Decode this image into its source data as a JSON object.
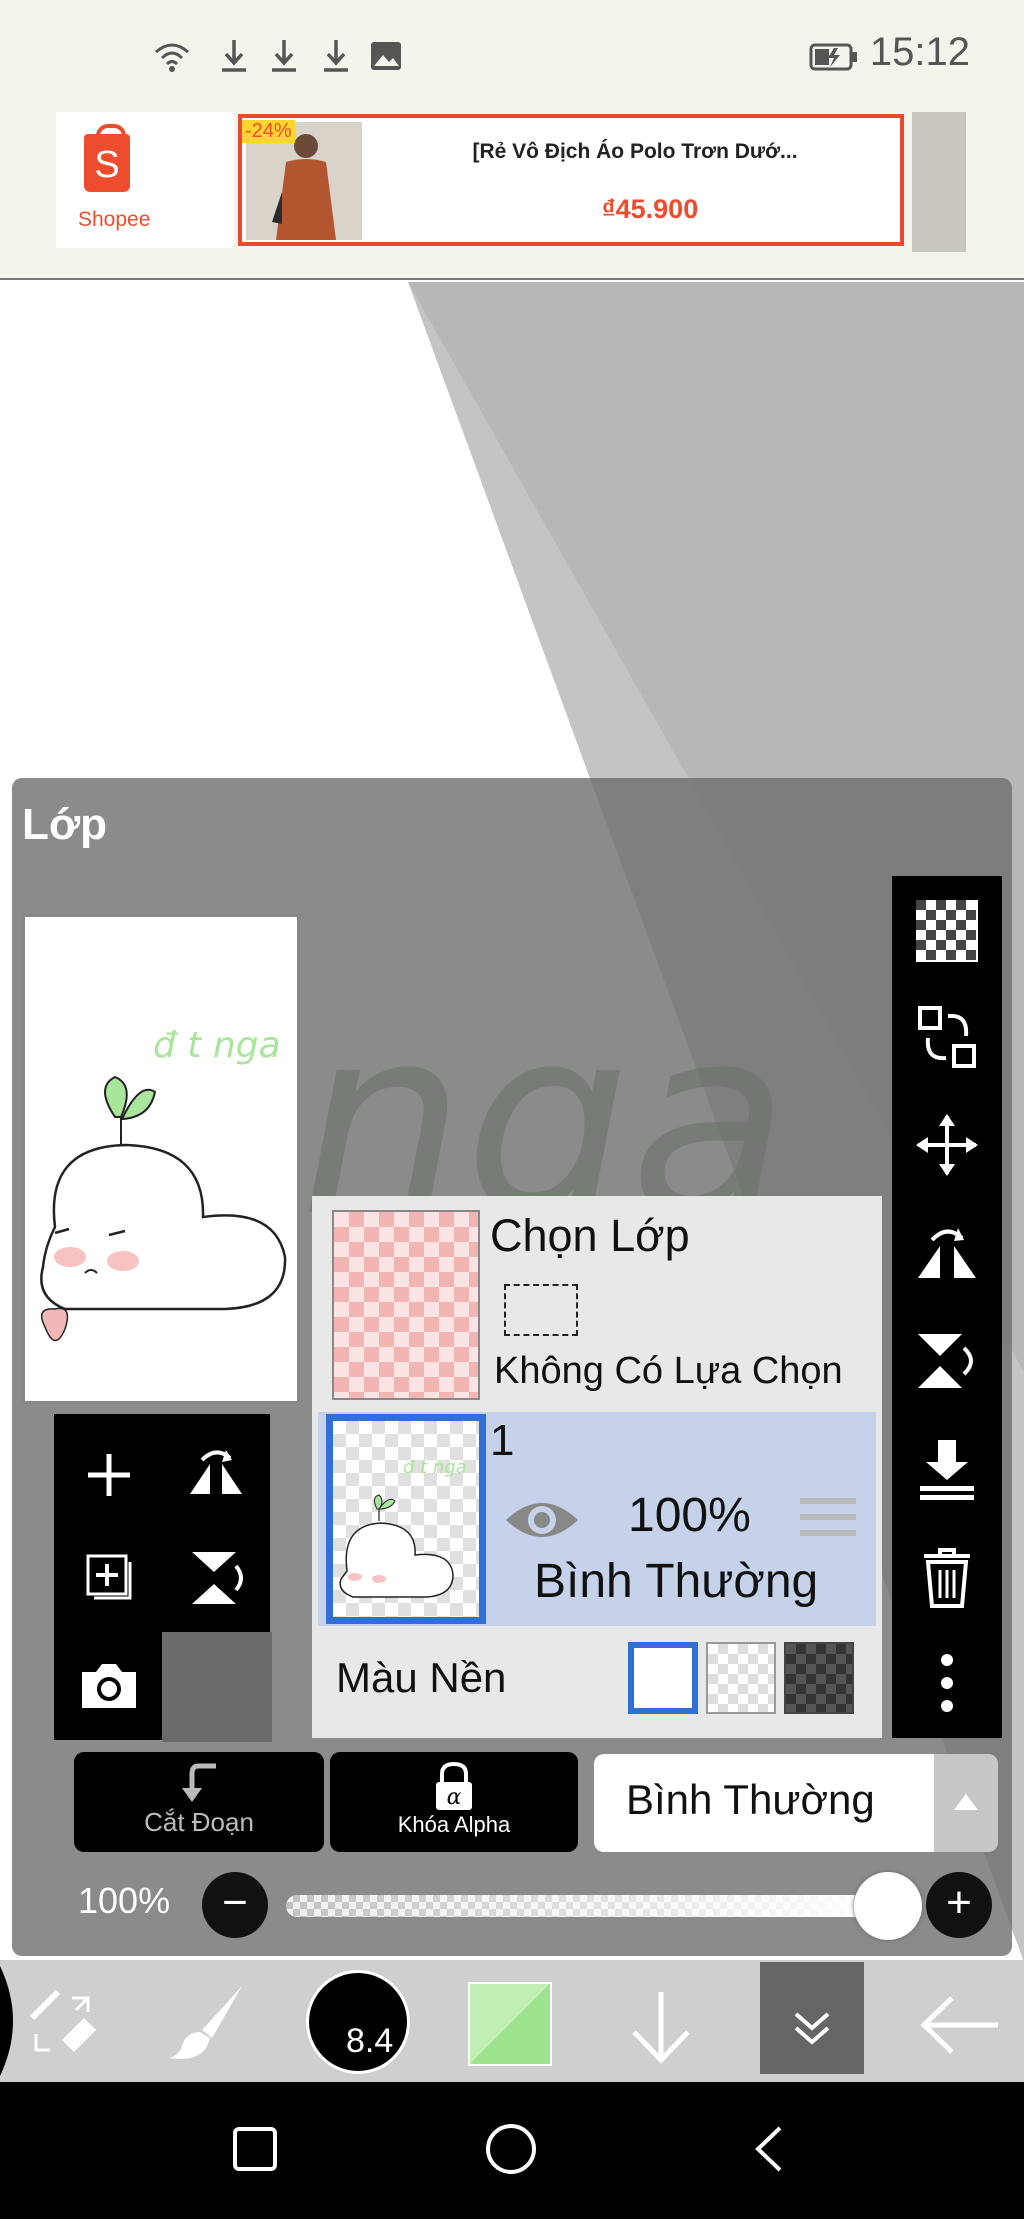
{
  "status_bar": {
    "time": "15:12",
    "icons": [
      "wifi-icon",
      "download-icon",
      "download-icon",
      "download-icon",
      "image-icon",
      "battery-charging-icon"
    ]
  },
  "ad": {
    "brand": "Shopee",
    "brand_letter": "S",
    "discount": "-24%",
    "title": "[Rẻ Vô Địch Áo Polo Trơn Dướ...",
    "price": "₫45.900",
    "brand_color": "#ee4d2d"
  },
  "layer_panel": {
    "title": "Lớp",
    "selection_layer": {
      "title": "Chọn Lớp",
      "status": "Không Có Lựa Chọn"
    },
    "layers": [
      {
        "name": "1",
        "opacity": "100%",
        "blend_mode": "Bình Thường",
        "visible_icon": "eye-icon",
        "selected": true
      }
    ],
    "background": {
      "label": "Màu Nền",
      "options": [
        "white",
        "transparent",
        "dark-checker"
      ],
      "selected": "white"
    },
    "clip_button": "Cắt Đoạn",
    "alpha_lock_button": "Khóa Alpha",
    "alpha_symbol": "α",
    "blend_mode": "Bình Thường",
    "opacity_label": "100%",
    "opacity_value": 1.0,
    "minus": "−",
    "plus": "+"
  },
  "preview_art": {
    "signature": "đ t nga",
    "watermark": "nga"
  },
  "right_toolbar": [
    "checker-icon",
    "swap-layers-icon",
    "move-icon",
    "flip-horizontal-icon",
    "flip-vertical-icon",
    "merge-down-icon",
    "trash-icon",
    "more-icon"
  ],
  "left_tools": [
    "add-layer-icon",
    "flip-horizontal-icon",
    "add-copy-icon",
    "flip-vertical-icon",
    "camera-icon"
  ],
  "bottom_toolbar": {
    "brush_size": "8.4",
    "color": "#a9e59b",
    "tools": [
      "transform-icon",
      "brush-icon",
      "brush-size",
      "color-swatch",
      "down-arrow-icon",
      "layers-collapse-icon",
      "back-arrow-icon"
    ]
  },
  "nav_bar": [
    "recent-apps-icon",
    "home-icon",
    "back-icon"
  ]
}
